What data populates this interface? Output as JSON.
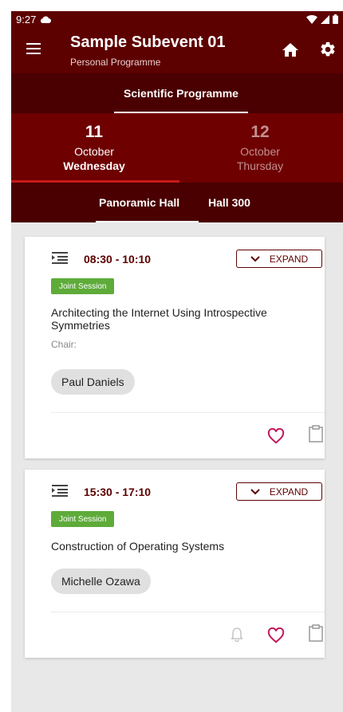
{
  "status_bar": {
    "time": "9:27"
  },
  "app_bar": {
    "title": "Sample Subevent 01",
    "subtitle": "Personal Programme"
  },
  "main_tabs": [
    {
      "label": "Scientific Programme",
      "selected": true
    }
  ],
  "date_tabs": [
    {
      "day": "11",
      "month": "October",
      "weekday": "Wednesday",
      "selected": true
    },
    {
      "day": "12",
      "month": "October",
      "weekday": "Thursday",
      "selected": false
    }
  ],
  "hall_tabs": [
    {
      "label": "Panoramic Hall",
      "selected": true
    },
    {
      "label": "Hall 300",
      "selected": false
    }
  ],
  "sessions": [
    {
      "time": "08:30 - 10:10",
      "expand_label": "EXPAND",
      "badge": "Joint Session",
      "title": "Architecting the Internet Using Introspective Symmetries",
      "chair_label": "Chair:",
      "people": [
        "Paul Daniels"
      ]
    },
    {
      "time": "15:30 - 17:10",
      "expand_label": "EXPAND",
      "badge": "Joint Session",
      "title": "Construction of Operating Systems",
      "people": [
        "Michelle Ozawa"
      ]
    }
  ],
  "colors": {
    "primary_dark": "#5d0000",
    "primary": "#6e0000",
    "indicator_red": "#c91919",
    "badge_green": "#5eab3a",
    "heart": "#c2185b"
  }
}
